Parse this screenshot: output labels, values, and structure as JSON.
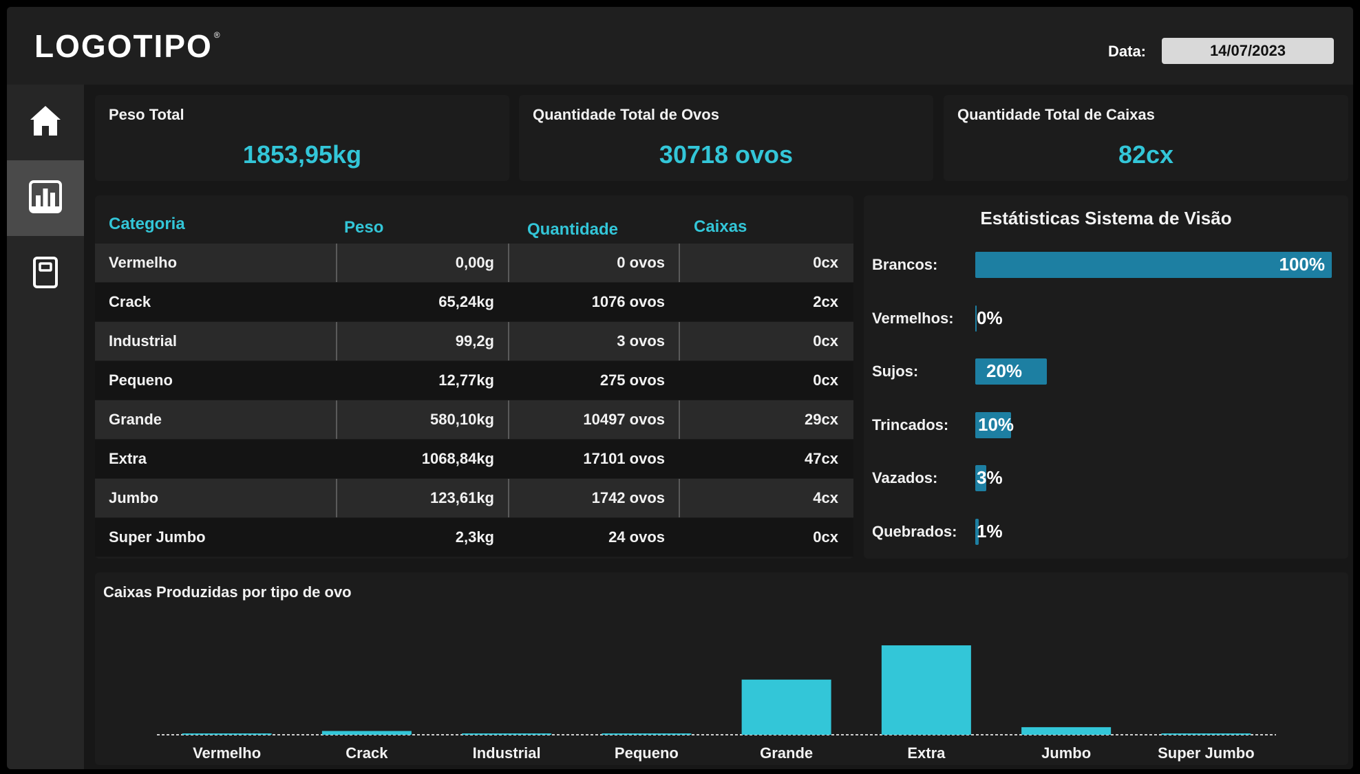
{
  "header": {
    "logo": "LOGOTIPO",
    "logo_mark": "®",
    "date_label": "Data:",
    "date_value": "14/07/2023"
  },
  "sidebar": {
    "items": [
      {
        "name": "home",
        "icon": "home-icon"
      },
      {
        "name": "dashboard",
        "icon": "bar-chart-icon",
        "active": true
      },
      {
        "name": "report",
        "icon": "document-icon"
      }
    ]
  },
  "kpis": [
    {
      "title": "Peso Total",
      "value": "1853,95kg"
    },
    {
      "title": "Quantidade Total de Ovos",
      "value": "30718 ovos"
    },
    {
      "title": "Quantidade Total de Caixas",
      "value": "82cx"
    }
  ],
  "table": {
    "headers": [
      "Categoria",
      "Peso",
      "Quantidade",
      "Caixas"
    ],
    "rows": [
      [
        "Vermelho",
        "0,00g",
        "0 ovos",
        "0cx"
      ],
      [
        "Crack",
        "65,24kg",
        "1076 ovos",
        "2cx"
      ],
      [
        "Industrial",
        "99,2g",
        "3 ovos",
        "0cx"
      ],
      [
        "Pequeno",
        "12,77kg",
        "275 ovos",
        "0cx"
      ],
      [
        "Grande",
        "580,10kg",
        "10497 ovos",
        "29cx"
      ],
      [
        "Extra",
        "1068,84kg",
        "17101 ovos",
        "47cx"
      ],
      [
        "Jumbo",
        "123,61kg",
        "1742 ovos",
        "4cx"
      ],
      [
        "Super Jumbo",
        "2,3kg",
        "24 ovos",
        "0cx"
      ]
    ]
  },
  "vision": {
    "title": "Estátisticas Sistema de Visão",
    "items": [
      {
        "label": "Brancos:",
        "percent": 100,
        "text": "100%"
      },
      {
        "label": "Vermelhos:",
        "percent": 0,
        "text": "0%"
      },
      {
        "label": "Sujos:",
        "percent": 20,
        "text": "20%"
      },
      {
        "label": "Trincados:",
        "percent": 10,
        "text": "10%"
      },
      {
        "label": "Vazados:",
        "percent": 3,
        "text": "3%"
      },
      {
        "label": "Quebrados:",
        "percent": 1,
        "text": "1%"
      }
    ],
    "bar_color": "#1d7fa2"
  },
  "colors": {
    "accent": "#33c6d8",
    "background": "#171717",
    "card": "#1c1c1c"
  },
  "chart_data": {
    "type": "bar",
    "title": "Caixas Produzidas por tipo de ovo",
    "categories": [
      "Vermelho",
      "Crack",
      "Industrial",
      "Pequeno",
      "Grande",
      "Extra",
      "Jumbo",
      "Super Jumbo"
    ],
    "values": [
      0,
      2,
      0,
      0,
      29,
      47,
      4,
      0
    ],
    "xlabel": "",
    "ylabel": "",
    "ylim": [
      0,
      47
    ],
    "grid": false,
    "color": "#33c6d8"
  }
}
